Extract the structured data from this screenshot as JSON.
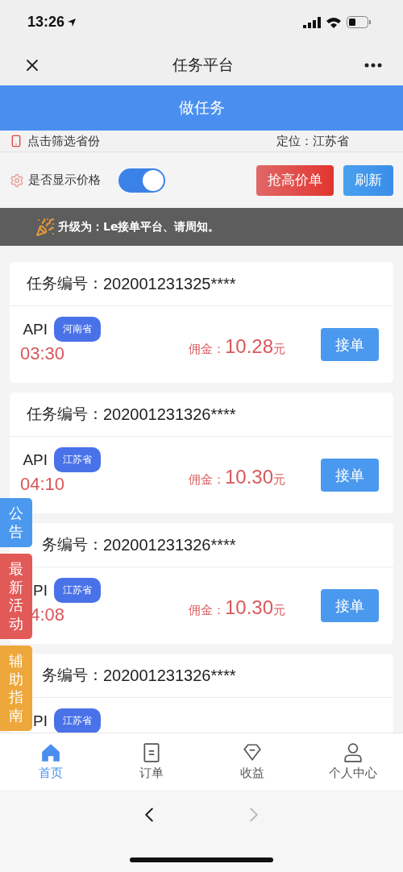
{
  "status_bar": {
    "time": "13:26"
  },
  "nav": {
    "title": "任务平台"
  },
  "header": {
    "title": "做任务"
  },
  "filter": {
    "label": "点击筛选省份",
    "location": "定位：江苏省"
  },
  "controls": {
    "price_toggle": {
      "label": "是否显示价格",
      "on": true
    },
    "buttons": [
      {
        "label": "抢高价单",
        "kind": "danger"
      },
      {
        "label": "刷新",
        "kind": "primary"
      }
    ]
  },
  "notice": {
    "text": "升级为：Le接单平台、请周知。"
  },
  "tasks": [
    {
      "label": "任务编号：",
      "number": "202001231325****",
      "api": "API",
      "province": "河南省",
      "time": "03:30",
      "commission_label": "佣金：",
      "amount": "10.28",
      "unit": "元",
      "action": "接单"
    },
    {
      "label": "任务编号：",
      "number": "202001231326****",
      "api": "API",
      "province": "江苏省",
      "time": "04:10",
      "commission_label": "佣金：",
      "amount": "10.30",
      "unit": "元",
      "action": "接单"
    },
    {
      "label": "务编号：",
      "number": "202001231326****",
      "api": "PI",
      "province": "江苏省",
      "time": "4:08",
      "commission_label": "佣金：",
      "amount": "10.30",
      "unit": "元",
      "action": "接单"
    },
    {
      "label": "务编号：",
      "number": "202001231326****",
      "api": "PI",
      "province": "江苏省"
    }
  ],
  "side_tabs": [
    {
      "label": "公告",
      "color": "#4a99ee"
    },
    {
      "label": "最新活动",
      "color": "#e25a57"
    },
    {
      "label": "辅助指南",
      "color": "#eda73a"
    }
  ],
  "tab_bar": [
    {
      "label": "首页",
      "selected": true
    },
    {
      "label": "订单",
      "selected": false
    },
    {
      "label": "收益",
      "selected": false
    },
    {
      "label": "个人中心",
      "selected": false
    }
  ]
}
